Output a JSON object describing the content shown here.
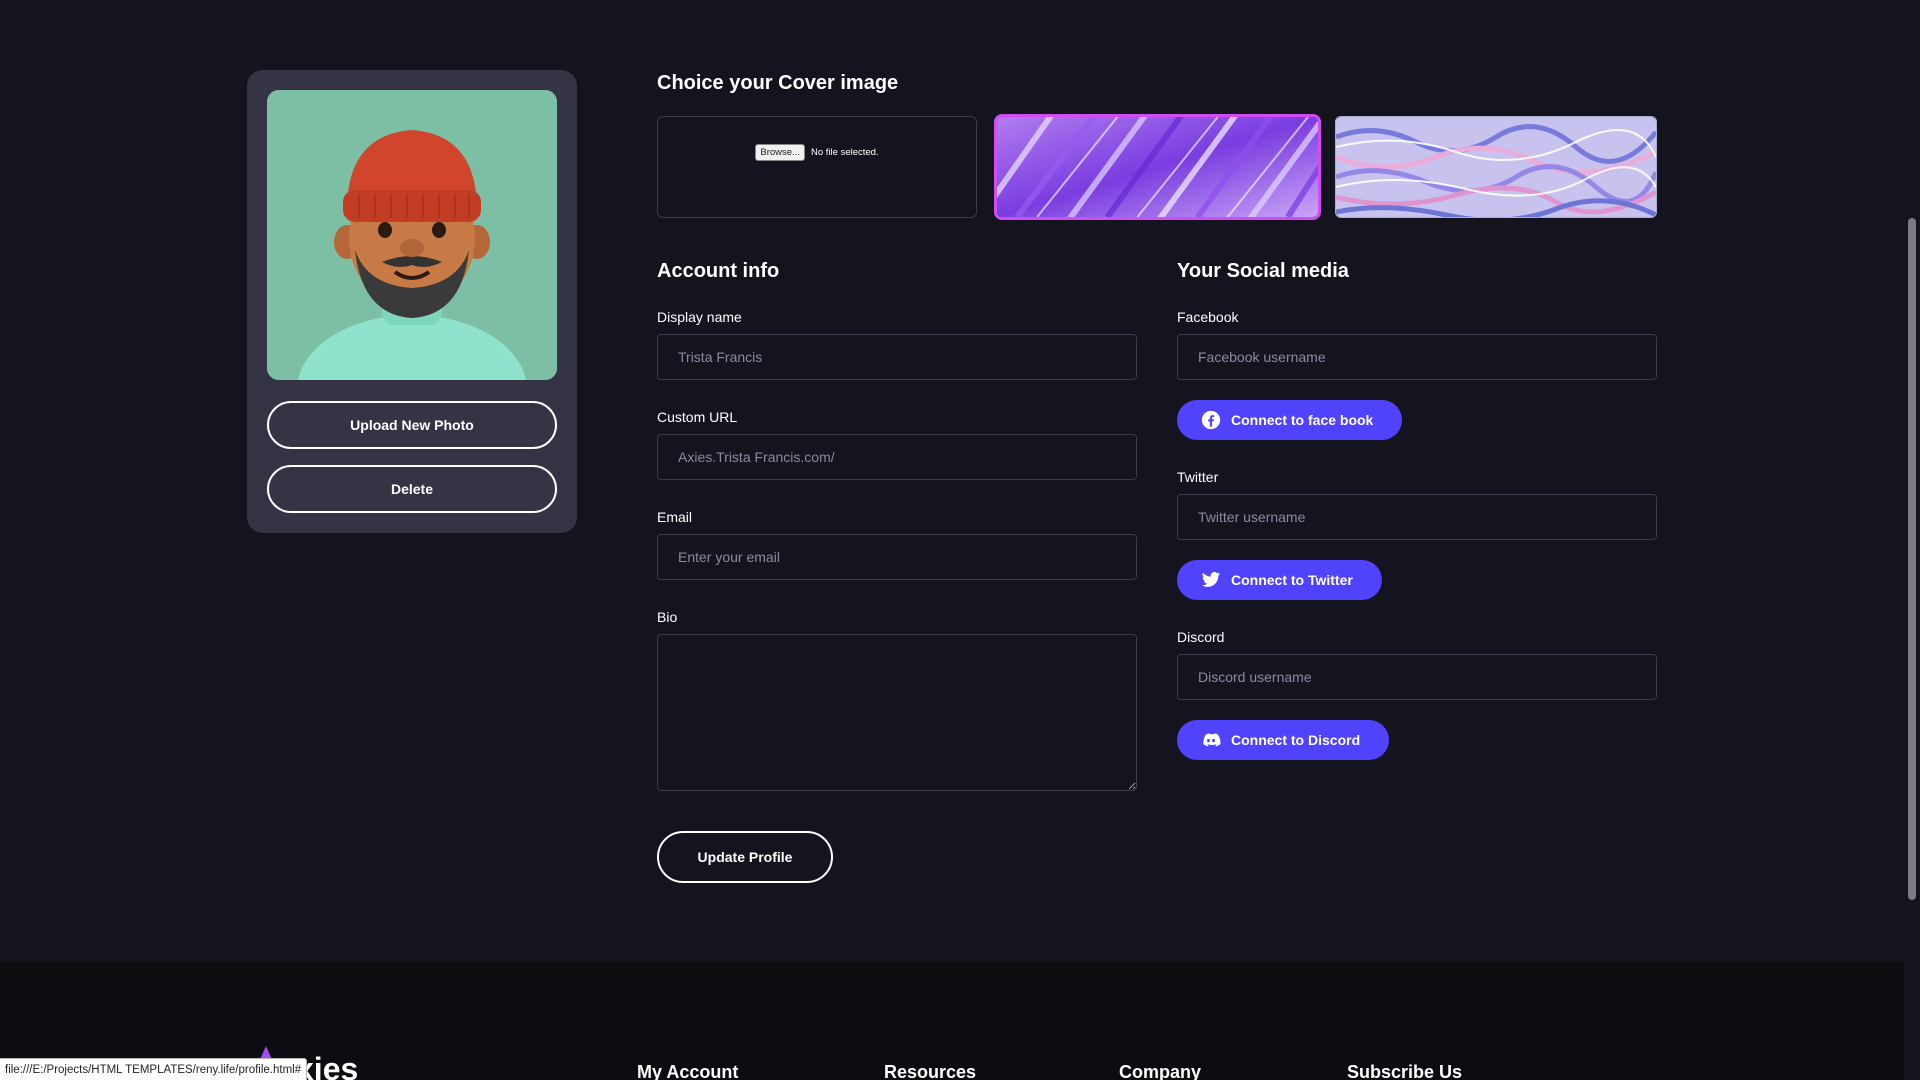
{
  "avatar": {
    "upload_label": "Upload New Photo",
    "delete_label": "Delete"
  },
  "cover": {
    "title": "Choice your Cover image",
    "browse_label": "Browse...",
    "no_file_label": "No file selected."
  },
  "account": {
    "title": "Account info",
    "display_name": {
      "label": "Display name",
      "placeholder": "Trista Francis"
    },
    "custom_url": {
      "label": "Custom URL",
      "placeholder": "Axies.Trista Francis.com/"
    },
    "email": {
      "label": "Email",
      "placeholder": "Enter your email"
    },
    "bio": {
      "label": "Bio",
      "value": ""
    }
  },
  "social": {
    "title": "Your Social media",
    "facebook": {
      "label": "Facebook",
      "placeholder": "Facebook username",
      "button": "Connect to face book",
      "icon": "facebook-icon"
    },
    "twitter": {
      "label": "Twitter",
      "placeholder": "Twitter username",
      "button": "Connect to Twitter",
      "icon": "twitter-icon"
    },
    "discord": {
      "label": "Discord",
      "placeholder": "Discord username",
      "button": "Connect to Discord",
      "icon": "discord-icon"
    }
  },
  "update_label": "Update Profile",
  "footer": {
    "logo_text": "xies",
    "columns": [
      "My Account",
      "Resources",
      "Company",
      "Subscribe Us"
    ]
  },
  "status_url": "file:///E:/Projects/HTML TEMPLATES/reny.life/profile.html#",
  "colors": {
    "background": "#14141f",
    "card": "#343444",
    "accent": "#5142fc",
    "selected_border": "#d14cf2",
    "footer": "#0d0d11"
  }
}
